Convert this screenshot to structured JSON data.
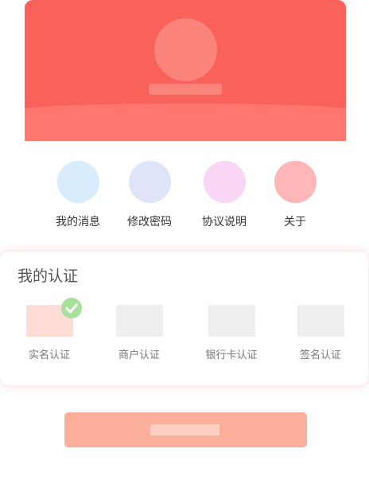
{
  "colors": {
    "header_bg": "#f8625a",
    "header_wave": "#ff776f",
    "avatar_placeholder": "#fa847b",
    "button_bg": "#fbaf9b",
    "verified_badge": "#a6e09b"
  },
  "quick_menu": [
    {
      "label": "我的消息",
      "icon": "messages-icon",
      "color": "#d9ecfb"
    },
    {
      "label": "修改密码",
      "icon": "password-icon",
      "color": "#dfe4f8"
    },
    {
      "label": "协议说明",
      "icon": "agreement-icon",
      "color": "#f9d6f5"
    },
    {
      "label": "关于",
      "icon": "about-icon",
      "color": "#ffb6b6"
    }
  ],
  "certification": {
    "title": "我的认证",
    "items": [
      {
        "label": "实名认证",
        "color": "#ffdcd5",
        "verified": true
      },
      {
        "label": "商户认证",
        "color": "#eeeeee",
        "verified": false
      },
      {
        "label": "银行卡认证",
        "color": "#eeeeee",
        "verified": false
      },
      {
        "label": "签名认证",
        "color": "#eeeeee",
        "verified": false
      }
    ]
  }
}
